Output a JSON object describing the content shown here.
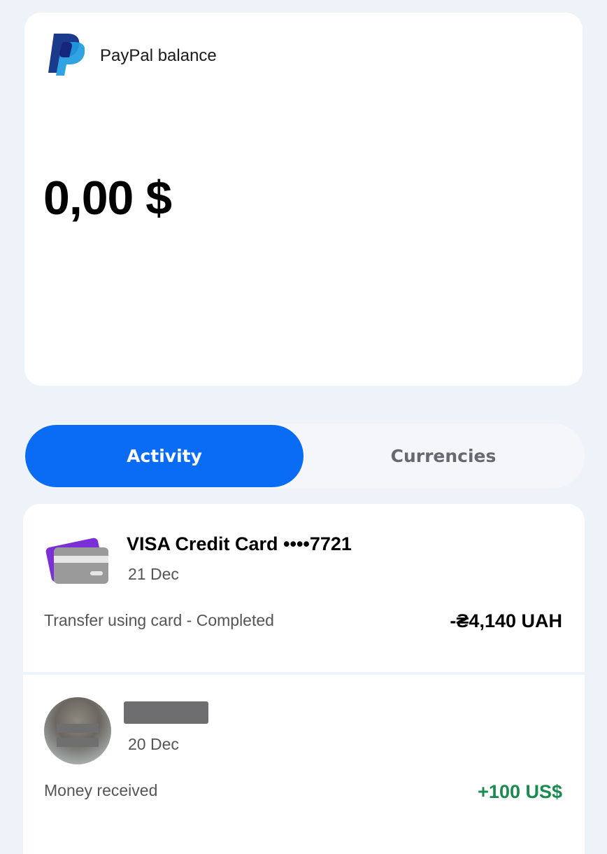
{
  "balance": {
    "label": "PayPal balance",
    "amount": "0,00 $"
  },
  "tabs": [
    {
      "label": "Activity",
      "selected": true
    },
    {
      "label": "Currencies",
      "selected": false
    }
  ],
  "transactions": [
    {
      "title": "VISA Credit Card ••••7721",
      "date": "21 Dec",
      "description": "Transfer using card - Completed",
      "amount": "-₴4,140 UAH",
      "icon": "credit-card-icon"
    },
    {
      "title": "",
      "date": "20 Dec",
      "description": "Money received",
      "amount": "+100 US$",
      "icon": "avatar"
    }
  ],
  "colors": {
    "accent": "#0a6cf4",
    "positive": "#1a8a4f",
    "background": "#eef2f9"
  }
}
